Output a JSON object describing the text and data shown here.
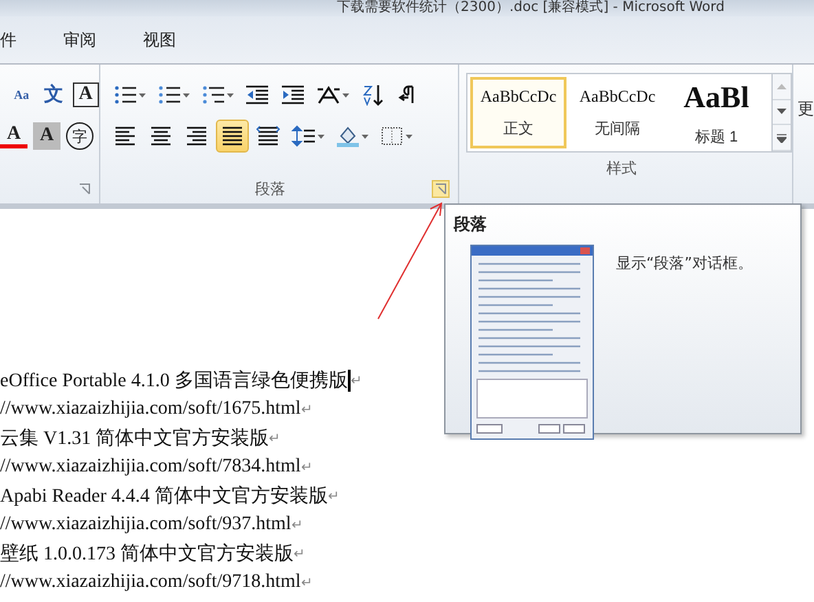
{
  "window": {
    "title": "下载需要软件统计（2300）.doc [兼容模式] - Microsoft Word"
  },
  "tabs": [
    {
      "label": "件",
      "selected": false
    },
    {
      "label": "审阅",
      "selected": false
    },
    {
      "label": "视图",
      "selected": false
    }
  ],
  "font_group": {
    "row_1": [
      {
        "glyph": "Aa",
        "kind": "phonetic"
      },
      {
        "glyph": "文",
        "kind": "wen"
      },
      {
        "glyph": "A",
        "kind": "boxed"
      }
    ],
    "row_2": [
      {
        "glyph": "A",
        "kind": "color"
      },
      {
        "glyph": "A",
        "kind": "shaded"
      },
      {
        "glyph": "字",
        "kind": "circled"
      }
    ]
  },
  "paragraph_group": {
    "label": "段落",
    "launcher_highlighted": true,
    "row_1": [
      {
        "kind": "bullets",
        "dropdown": true,
        "selected": false
      },
      {
        "kind": "numbering",
        "dropdown": true,
        "selected": false
      },
      {
        "kind": "multilevel",
        "dropdown": true,
        "selected": false
      },
      {
        "kind": "outdent",
        "dropdown": false,
        "selected": false
      },
      {
        "kind": "indent",
        "dropdown": false,
        "selected": false
      },
      {
        "kind": "asian-layout",
        "dropdown": true,
        "selected": false
      },
      {
        "kind": "sort",
        "dropdown": false,
        "selected": false
      },
      {
        "kind": "marks",
        "dropdown": false,
        "selected": false
      }
    ],
    "row_2": [
      {
        "kind": "align-left",
        "dropdown": false,
        "selected": false
      },
      {
        "kind": "align-center",
        "dropdown": false,
        "selected": false
      },
      {
        "kind": "align-right",
        "dropdown": false,
        "selected": false
      },
      {
        "kind": "justify",
        "dropdown": false,
        "selected": true
      },
      {
        "kind": "distribute",
        "dropdown": false,
        "selected": false
      },
      {
        "kind": "line-spacing",
        "dropdown": true,
        "selected": false
      },
      {
        "kind": "shading",
        "dropdown": true,
        "selected": false
      },
      {
        "kind": "borders",
        "dropdown": true,
        "selected": false
      }
    ]
  },
  "styles_group": {
    "label": "样式",
    "styles": [
      {
        "preview": "AaBbCcDc",
        "name": "正文",
        "kind": "normal",
        "selected": true
      },
      {
        "preview": "AaBbCcDc",
        "name": "无间隔",
        "kind": "normal",
        "selected": false
      },
      {
        "preview": "AaBl",
        "name": "标题 1",
        "kind": "heading",
        "selected": false
      }
    ],
    "more": "更"
  },
  "tooltip": {
    "title": "段落",
    "description": "显示“段落”对话框。"
  },
  "document": {
    "lines": [
      {
        "text": "eOffice Portable 4.1.0 多国语言绿色便携版",
        "mark": "↵",
        "cursor": true
      },
      {
        "text": "//www.xiazaizhijia.com/soft/1675.html",
        "mark": "↵",
        "cursor": false
      },
      {
        "text": "云集  V1.31  简体中文官方安装版",
        "mark": "↵",
        "cursor": false
      },
      {
        "text": "//www.xiazaizhijia.com/soft/7834.html",
        "mark": "↵",
        "cursor": false
      },
      {
        "text": "Apabi Reader 4.4.4  简体中文官方安装版",
        "mark": "↵",
        "cursor": false
      },
      {
        "text": "//www.xiazaizhijia.com/soft/937.html",
        "mark": "↵",
        "cursor": false
      },
      {
        "text": "壁纸  1.0.0.173  简体中文官方安装版",
        "mark": "↵",
        "cursor": false
      },
      {
        "text": "//www.xiazaizhijia.com/soft/9718.html",
        "mark": "↵",
        "cursor": false
      }
    ]
  }
}
